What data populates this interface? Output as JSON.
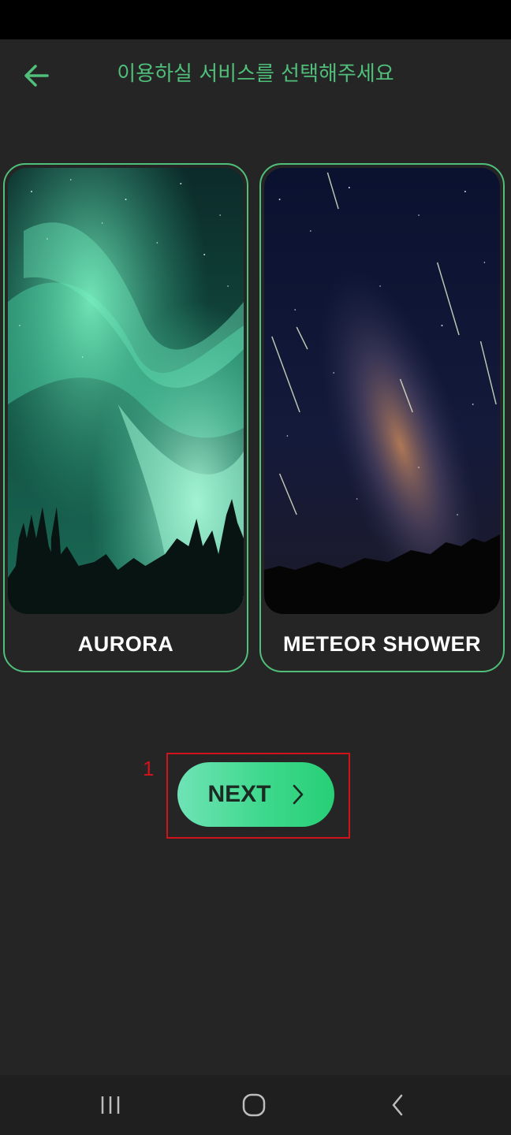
{
  "header": {
    "title": "이용하실 서비스를 선택해주세요",
    "back_icon": "arrow-left-icon"
  },
  "services": [
    {
      "label": "AURORA",
      "image": "aurora-photo"
    },
    {
      "label": "METEOR SHOWER",
      "image": "meteor-shower-photo"
    }
  ],
  "next_button": {
    "label": "NEXT",
    "icon": "chevron-right-icon"
  },
  "annotation": {
    "number": "1"
  },
  "nav_bar": {
    "items": [
      "recent-apps-icon",
      "home-icon",
      "back-icon"
    ]
  },
  "colors": {
    "accent": "#4fbf7a",
    "background": "#252525",
    "button_gradient_start": "#6fe3b6",
    "button_gradient_end": "#27cf77",
    "annotation": "#d0131b"
  }
}
